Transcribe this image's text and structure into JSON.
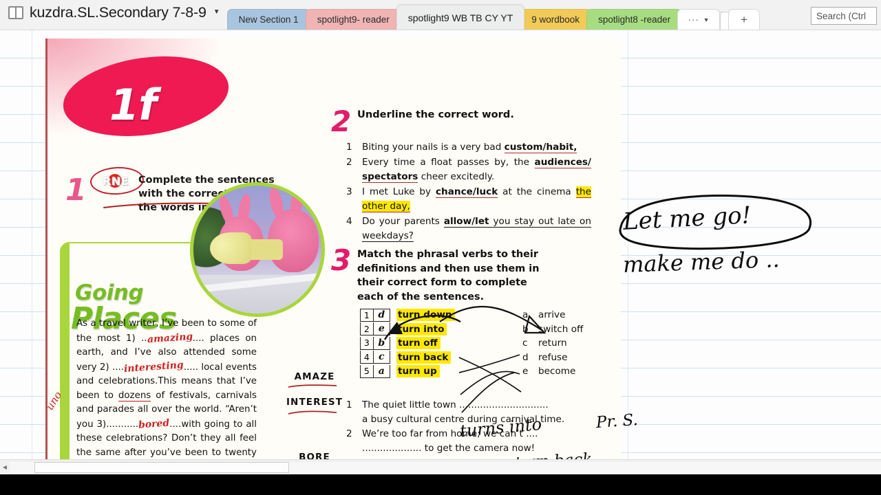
{
  "window": {
    "notebook_title": "kuzdra.SL.Secondary 7-8-9",
    "notebook_icon": "notebook-icon",
    "caret_icon": "chevron-down-icon",
    "search_placeholder": "Search (Ctrl",
    "search_value": ""
  },
  "tabs": [
    {
      "label": "New Section 1",
      "color": "#a8c4de",
      "active": false
    },
    {
      "label": "spotlight9- reader",
      "color": "#f0b4b4",
      "active": false
    },
    {
      "label": "spotlight9 WB TB CY YT",
      "color": "#eceded",
      "active": true
    },
    {
      "label": "9 wordbook",
      "color": "#f2ca57",
      "active": false
    },
    {
      "label": "spotlight8 -reader",
      "color": "#a7dd80",
      "active": false
    }
  ],
  "tab_controls": {
    "overflow_dots": "···",
    "overflow_caret": "▼",
    "add_tab": "+"
  },
  "page": {
    "unit_label": "1f",
    "exercise1": {
      "number": "1",
      "badge": "RNE",
      "text": "Complete the sentences with the correct form of the words in bold."
    },
    "logo": {
      "line1": "Going",
      "line2": "Places"
    },
    "paragraph": {
      "pre1": "As a travel writer, I’ve been to some of the most 1) ..",
      "answer1": "amazing",
      "mid1": ".... places on earth, and I’ve also attended some very 2) ....",
      "answer2": "interesting",
      "mid2": "..... local events and celebrations.This means that I’ve been to ",
      "underlined": "dozens",
      "mid3": " of festivals, carnivals and parades all over the world. “Aren’t you 3)...........",
      "answer3": "bored",
      "post": "....with going to all these celebrations? Don’t they all feel the same after you’ve been to twenty or"
    },
    "margin_note": "uno",
    "words": [
      "AMAZE",
      "INTEREST",
      "BORE"
    ],
    "exercise2": {
      "number": "2",
      "title": "Underline the correct word.",
      "items": [
        {
          "n": "1",
          "a": "Biting your nails is a very bad ",
          "bold": "custom/habit,",
          "c": ""
        },
        {
          "n": "2",
          "a": "Every time a float passes by, the ",
          "bold": "audiences/ spectators",
          "c": " cheer excitedly."
        },
        {
          "n": "3",
          "a": "I met Luke by ",
          "bold": "chance/luck",
          "c": " at the cinema ",
          "hl": "the other day,"
        },
        {
          "n": "4",
          "a": "Do your parents ",
          "bold": "allow/let",
          "c": " you stay out late on weekdays?"
        }
      ]
    },
    "exercise3": {
      "number": "3",
      "title": "Match the phrasal verbs to their definitions and then use them in their correct form to complete each of the sentences.",
      "match_rows": [
        {
          "num": "1",
          "answer": "d",
          "verb": "turn down"
        },
        {
          "num": "2",
          "answer": "e",
          "verb": "turn into"
        },
        {
          "num": "3",
          "answer": "b",
          "verb": "turn off"
        },
        {
          "num": "4",
          "answer": "c",
          "verb": "turn back"
        },
        {
          "num": "5",
          "answer": "a",
          "verb": "turn up"
        }
      ],
      "definitions": [
        {
          "letter": "a",
          "text": "arrive"
        },
        {
          "letter": "b",
          "text": "switch off"
        },
        {
          "letter": "c",
          "text": "return"
        },
        {
          "letter": "d",
          "text": "refuse"
        },
        {
          "letter": "e",
          "text": "become"
        }
      ],
      "sentences": [
        {
          "n": "1",
          "a": "The quiet little town ....",
          "blank": "..........................",
          "b": "a busy cultural centre during carnival time."
        },
        {
          "n": "2",
          "a": "We’re too far from home; we can’t ....",
          "blank": "....................",
          "b": " to get the camera now!"
        }
      ]
    }
  },
  "annotations": {
    "note1": "Let me go!",
    "note2": "make me do ..",
    "note3": "Pr. S.",
    "inline1": "turns into",
    "inline2": "turn back"
  },
  "colors": {
    "accent_pink": "#e21c6b",
    "accent_red": "#ef1a52",
    "accent_green": "#76bd22",
    "highlight_yellow": "#ffe800",
    "rule_blue": "#cfe0ea"
  },
  "scrollbar": {
    "left_arrow": "◀"
  }
}
